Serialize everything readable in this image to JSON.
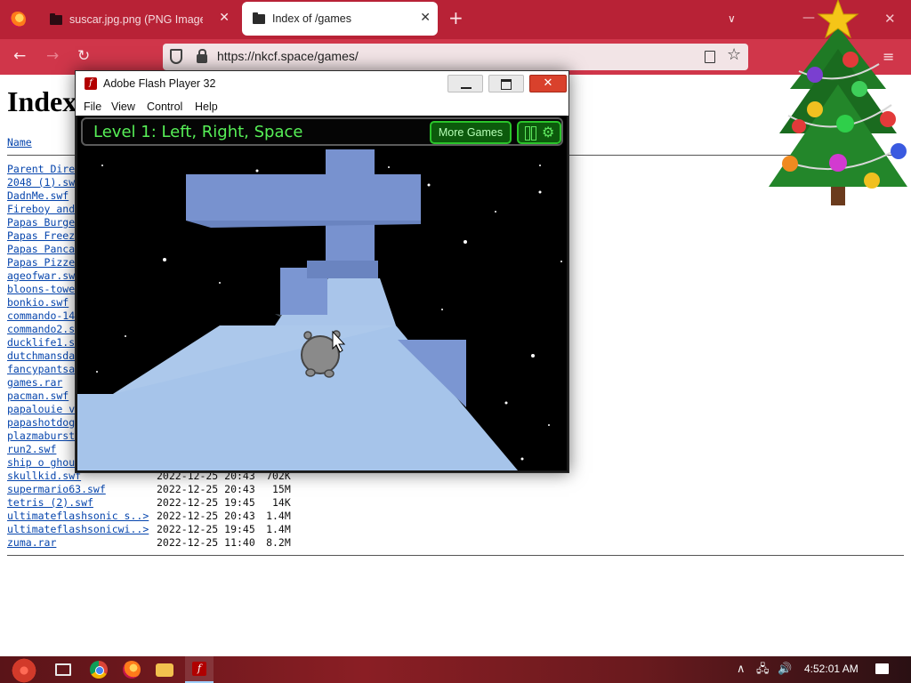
{
  "browser": {
    "tabs": [
      {
        "title": "suscar.jpg.png (PNG Image, 35"
      },
      {
        "title": "Index of /games"
      }
    ],
    "url": "https://nkcf.space/games/"
  },
  "page": {
    "heading": "Index",
    "column_name": "Name",
    "files": [
      {
        "name": "Parent Dire",
        "date": "",
        "size": ""
      },
      {
        "name": "2048 (1).sw",
        "date": "",
        "size": ""
      },
      {
        "name": "DadnMe.swf",
        "date": "",
        "size": ""
      },
      {
        "name": "Fireboy and",
        "date": "",
        "size": ""
      },
      {
        "name": "Papas Burge",
        "date": "",
        "size": ""
      },
      {
        "name": "Papas Freez",
        "date": "",
        "size": ""
      },
      {
        "name": "Papas Panca",
        "date": "",
        "size": ""
      },
      {
        "name": "Papas Pizze",
        "date": "",
        "size": ""
      },
      {
        "name": "ageofwar.sw",
        "date": "",
        "size": ""
      },
      {
        "name": "bloons-towe",
        "date": "",
        "size": ""
      },
      {
        "name": "bonkio.swf",
        "date": "",
        "size": ""
      },
      {
        "name": "commando-14",
        "date": "",
        "size": ""
      },
      {
        "name": "commando2.s",
        "date": "",
        "size": ""
      },
      {
        "name": "ducklife1.s",
        "date": "",
        "size": ""
      },
      {
        "name": "dutchmansda",
        "date": "",
        "size": ""
      },
      {
        "name": "fancypantsa",
        "date": "",
        "size": ""
      },
      {
        "name": "games.rar",
        "date": "",
        "size": ""
      },
      {
        "name": "pacman.swf",
        "date": "",
        "size": ""
      },
      {
        "name": "papalouie v",
        "date": "",
        "size": ""
      },
      {
        "name": "papashotdog",
        "date": "",
        "size": ""
      },
      {
        "name": "plazmaburst",
        "date": "",
        "size": ""
      },
      {
        "name": "run2.swf",
        "date": "",
        "size": ""
      },
      {
        "name": "ship o ghou",
        "date": "",
        "size": ""
      },
      {
        "name": "skullkid.swf",
        "date": "2022-12-25 20:43",
        "size": "702K"
      },
      {
        "name": "supermario63.swf",
        "date": "2022-12-25 20:43",
        "size": "15M"
      },
      {
        "name": "tetris (2).swf",
        "date": "2022-12-25 19:45",
        "size": "14K"
      },
      {
        "name": "ultimateflashsonic s..>",
        "date": "2022-12-25 20:43",
        "size": "1.4M"
      },
      {
        "name": "ultimateflashsonicwi..>",
        "date": "2022-12-25 19:45",
        "size": "1.4M"
      },
      {
        "name": "zuma.rar",
        "date": "2022-12-25 11:40",
        "size": "8.2M"
      }
    ]
  },
  "flash_window": {
    "title": "Adobe Flash Player 32",
    "menu": [
      "File",
      "View",
      "Control",
      "Help"
    ],
    "close_glyph": "✕",
    "level_text": "Level 1: Left, Right, Space",
    "more_games_label": "More Games",
    "gear_glyph": "⚙"
  },
  "taskbar": {
    "clock": "4:52:01 AM"
  },
  "glyphs": {
    "close": "✕",
    "plus": "+",
    "chevron": "∨",
    "minimize": "—",
    "back": "←",
    "forward": "→",
    "reload": "↻",
    "star": "☆",
    "hamburger": "≡",
    "tray_up": "∧",
    "tray_network": "🖧",
    "tray_volume": "🔊"
  },
  "colors": {
    "tab_strip": "#b82236",
    "toolbar": "#d0364a",
    "link": "#0645ad",
    "hud_green": "#57f057",
    "path_light": "#a6c4ea",
    "block_blue": "#7892cf"
  }
}
